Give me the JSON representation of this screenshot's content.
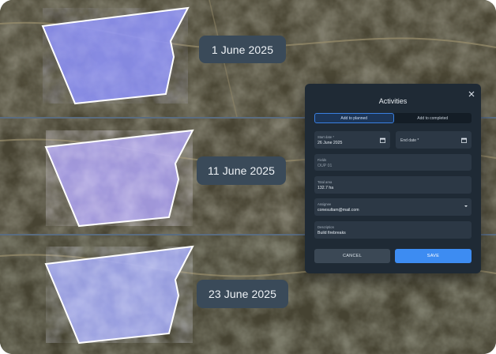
{
  "snapshots": [
    {
      "date": "1 June 2025"
    },
    {
      "date": "11 June 2025"
    },
    {
      "date": "23 June 2025"
    }
  ],
  "modal": {
    "title": "Activities",
    "tabs": [
      {
        "label": "Add to planned",
        "active": true
      },
      {
        "label": "Add to completed",
        "active": false
      }
    ],
    "start_date": {
      "label": "Start date *",
      "value": "26 June 2025"
    },
    "end_date": {
      "placeholder": "End date *"
    },
    "fields": {
      "label": "Fields",
      "value": "OUP 01"
    },
    "total_area": {
      "label": "Total area",
      "value": "132.7 ha"
    },
    "assignee": {
      "label": "Assignee",
      "value": "conesultam@mail.com"
    },
    "description": {
      "label": "Description",
      "value": "Build firebreaks"
    },
    "cancel_label": "CANCEL",
    "save_label": "SAVE"
  },
  "colors": {
    "accent": "#3d8cf2",
    "modal_bg": "#1f2a35",
    "field_bg": "#2c3845",
    "date_pill_bg": "#3a4a59",
    "divider": "#5e7289",
    "field_overlay": "#8a8cf0"
  },
  "icons": [
    "close-icon",
    "calendar-icon",
    "chevron-down-icon"
  ]
}
